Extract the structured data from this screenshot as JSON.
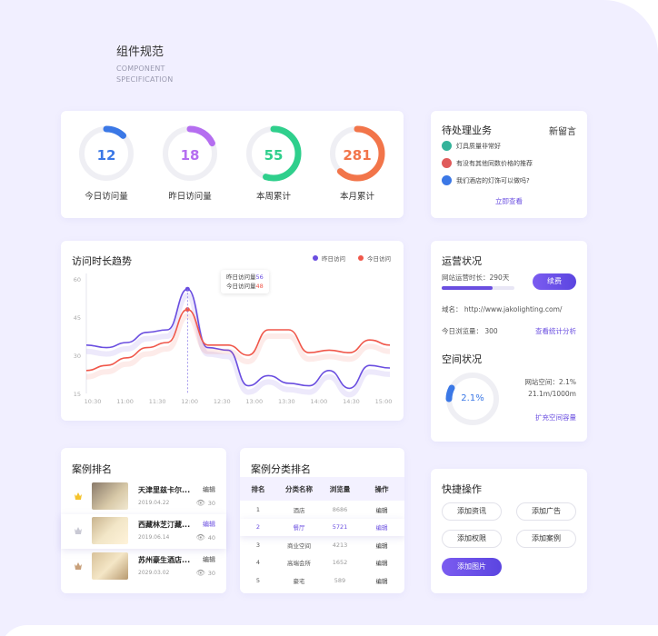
{
  "page": {
    "title": "组件规范",
    "subtitle_line1": "COMPONENT",
    "subtitle_line2": "SPECIFICATION"
  },
  "stats": [
    {
      "value": "12",
      "label": "今日访问量",
      "color": "#3b78e6",
      "progress": 0.12
    },
    {
      "value": "18",
      "label": "昨日访问量",
      "color": "#b56ef0",
      "progress": 0.18
    },
    {
      "value": "55",
      "label": "本周累计",
      "color": "#2fcf8c",
      "progress": 0.55
    },
    {
      "value": "281",
      "label": "本月累计",
      "color": "#f2754a",
      "progress": 0.62
    }
  ],
  "pending": {
    "title": "待处理业务",
    "new_label": "新留言",
    "items": [
      {
        "text": "灯具质量非常好",
        "color": "#34b39a"
      },
      {
        "text": "有没有其他同数价格的推荐",
        "color": "#e05a5a"
      },
      {
        "text": "我们酒店的灯饰可以做吗?",
        "color": "#3b78e6"
      }
    ],
    "link": "立即查看"
  },
  "chart": {
    "title": "访问时长趋势",
    "legend": [
      "昨日访问",
      "今日访问"
    ],
    "tooltip_line1_label": "昨日访问量",
    "tooltip_line1_value": "56",
    "tooltip_line2_label": "今日访问量",
    "tooltip_line2_value": "48"
  },
  "chart_data": {
    "type": "line",
    "x": [
      "10:30",
      "11:00",
      "11:30",
      "12:00",
      "12:30",
      "13:00",
      "13:30",
      "14:00",
      "14:30",
      "15:00"
    ],
    "yticks": [
      60,
      45,
      30,
      15
    ],
    "ylim": [
      15,
      60
    ],
    "series": [
      {
        "name": "昨日访问",
        "color": "#6a4ee0",
        "values": [
          34,
          33,
          35,
          39,
          40,
          56,
          33,
          32,
          18,
          22,
          19,
          18,
          24,
          17,
          26,
          25
        ]
      },
      {
        "name": "今日访问",
        "color": "#f0574a",
        "values": [
          24,
          26,
          29,
          33,
          35,
          48,
          34,
          34,
          30,
          40,
          40,
          31,
          32,
          31,
          36,
          34
        ]
      }
    ],
    "highlight_index": 5,
    "colors": {
      "yesterday": "#6a4ee0",
      "today": "#f0574a"
    }
  },
  "ops": {
    "title": "运营状况",
    "run_label": "网站运营时长：290天",
    "run_progress": 0.7,
    "renew": "续费",
    "domain": "域名：  http://www.jakolighting.com/",
    "views_today": "今日浏览量：  300",
    "stats_link": "查看统计分析",
    "space_title": "空间状况",
    "space_pct": "2.1%",
    "space_line1": "网站空间：2.1%",
    "space_line2": "21.1m/1000m",
    "space_link": "扩充空间容量"
  },
  "ranking": {
    "title": "案例排名",
    "edit_label": "编辑",
    "items": [
      {
        "name": "天津里兹卡尔...",
        "date": "2019.04.22",
        "views": "30",
        "badge": "gold"
      },
      {
        "name": "西藏林芝汀藏...",
        "date": "2019.06.14",
        "views": "40",
        "badge": "silver"
      },
      {
        "name": "苏州豪生酒店...",
        "date": "2029.03.02",
        "views": "30",
        "badge": "bronze"
      }
    ]
  },
  "category": {
    "title": "案例分类排名",
    "headers": [
      "排名",
      "分类名称",
      "浏览量",
      "操作"
    ],
    "rows": [
      [
        "1",
        "酒店",
        "8686",
        "编辑"
      ],
      [
        "2",
        "餐厅",
        "5721",
        "编辑"
      ],
      [
        "3",
        "商业空间",
        "4213",
        "编辑"
      ],
      [
        "4",
        "高端会所",
        "1652",
        "编辑"
      ],
      [
        "5",
        "豪宅",
        "589",
        "编辑"
      ]
    ]
  },
  "quick": {
    "title": "快捷操作",
    "buttons": [
      "添加资讯",
      "添加广告",
      "添加权限",
      "添加案例",
      "添加图片"
    ]
  }
}
